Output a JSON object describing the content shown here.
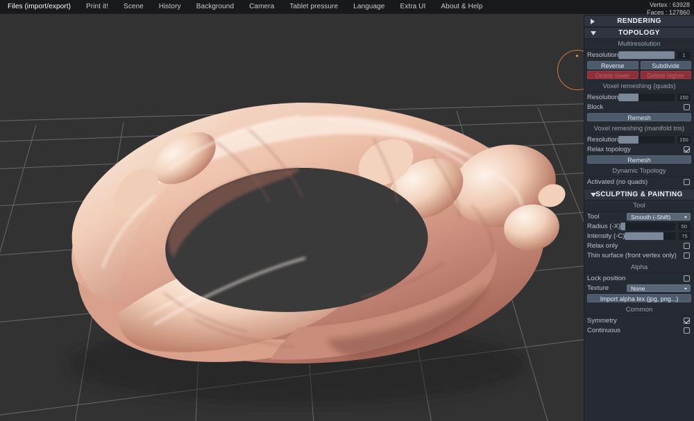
{
  "menu": {
    "items": [
      {
        "label": "Files (import/export)",
        "name": "menu-files"
      },
      {
        "label": "Print it!",
        "name": "menu-print"
      },
      {
        "label": "Scene",
        "name": "menu-scene"
      },
      {
        "label": "History",
        "name": "menu-history"
      },
      {
        "label": "Background",
        "name": "menu-background"
      },
      {
        "label": "Camera",
        "name": "menu-camera"
      },
      {
        "label": "Tablet pressure",
        "name": "menu-tablet-pressure"
      },
      {
        "label": "Language",
        "name": "menu-language"
      },
      {
        "label": "Extra UI",
        "name": "menu-extra-ui"
      },
      {
        "label": "About & Help",
        "name": "menu-about-help"
      }
    ]
  },
  "stats": {
    "vertex": "Vertex : 63928",
    "faces": "Faces : 127860"
  },
  "panel": {
    "rendering": {
      "title": "RENDERING",
      "expanded": false
    },
    "topology": {
      "title": "TOPOLOGY",
      "expanded": true
    },
    "multiresolution": {
      "title": "Multiresolution",
      "resolution_label": "Resolution",
      "resolution_value": "1",
      "resolution_fill_pct": 100,
      "reverse_label": "Reverse",
      "subdivide_label": "Subdivide",
      "delete_lower_label": "Delete lower",
      "delete_higher_label": "Delete higher"
    },
    "voxel_quads": {
      "title": "Voxel remeshing (quads)",
      "resolution_label": "Resolution",
      "resolution_value": "150",
      "resolution_fill_pct": 36,
      "block_label": "Block",
      "block_checked": false,
      "remesh_label": "Remesh"
    },
    "voxel_tris": {
      "title": "Voxel remeshing (manifold tris)",
      "resolution_label": "Resolution",
      "resolution_value": "150",
      "resolution_fill_pct": 36,
      "relax_label": "Relax topology",
      "relax_checked": true,
      "remesh_label": "Remesh"
    },
    "dynamic_topology": {
      "title": "Dynamic Topology",
      "activated_label": "Activated (no quads)",
      "activated_checked": false
    },
    "sculpting": {
      "title": "SCULPTING & PAINTING",
      "expanded": true
    },
    "tool": {
      "title": "Tool",
      "tool_label": "Tool",
      "tool_value": "Smooth (-Shift)",
      "radius_label": "Radius (-X)",
      "radius_value": "50",
      "radius_fill_pct": 9,
      "intensity_label": "Intensity (-C)",
      "intensity_value": "75",
      "intensity_fill_pct": 76,
      "relax_only_label": "Relax only",
      "relax_only_checked": false,
      "thin_surface_label": "Thin surface (front vertex only)",
      "thin_surface_checked": false
    },
    "alpha": {
      "title": "Alpha",
      "lock_position_label": "Lock position",
      "lock_position_checked": false,
      "texture_label": "Texture",
      "texture_value": "None",
      "import_label": "Import alpha tex (jpg, png...)"
    },
    "common": {
      "title": "Common",
      "symmetry_label": "Symmetry",
      "symmetry_checked": true,
      "continuous_label": "Continuous",
      "continuous_checked": false
    }
  },
  "viewport": {
    "model": "sculpted-torus-mesh",
    "brush_cursor": "orange-brush-circle",
    "grid": "perspective-floor-grid",
    "colors": {
      "background": "#323232",
      "grid_line": "#8b8b8b",
      "skin_highlight": "#f7e3d6",
      "skin_mid": "#e8b9a4",
      "skin_shadow": "#a8695a",
      "brush": "#c8803c"
    }
  }
}
